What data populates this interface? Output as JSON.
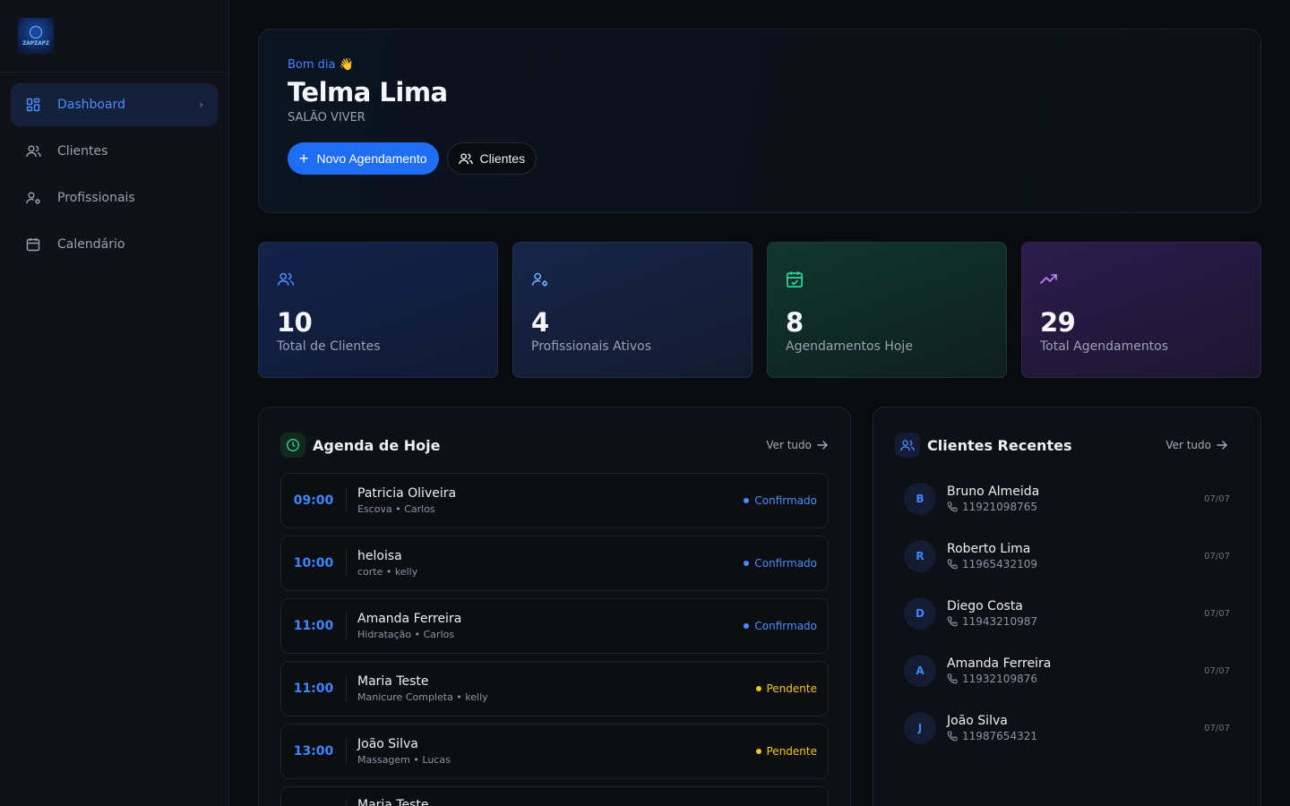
{
  "logo": {
    "text": "ZAPZAPZ"
  },
  "sidebar": {
    "items": [
      {
        "label": "Dashboard",
        "icon": "dashboard-icon",
        "active": true
      },
      {
        "label": "Clientes",
        "icon": "users-icon"
      },
      {
        "label": "Profissionais",
        "icon": "user-cog-icon"
      },
      {
        "label": "Calendário",
        "icon": "calendar-icon"
      }
    ]
  },
  "hero": {
    "greeting": "Bom dia 👋",
    "name": "Telma Lima",
    "salon": "SALÃO VIVER",
    "primary_button": "Novo Agendamento",
    "secondary_button": "Clientes"
  },
  "stats": [
    {
      "value": "10",
      "label": "Total de Clientes",
      "icon": "users-icon",
      "color": "#4a8dff"
    },
    {
      "value": "4",
      "label": "Profissionais Ativos",
      "icon": "user-cog-icon",
      "color": "#6ea8ff"
    },
    {
      "value": "8",
      "label": "Agendamentos Hoje",
      "icon": "calendar-check-icon",
      "color": "#2fd49a"
    },
    {
      "value": "29",
      "label": "Total Agendamentos",
      "icon": "trending-up-icon",
      "color": "#b98cff"
    }
  ],
  "agenda": {
    "title": "Agenda de Hoje",
    "see_all": "Ver tudo",
    "appointments": [
      {
        "time": "09:00",
        "client": "Patricia Oliveira",
        "details": "Escova • Carlos",
        "status": "Confirmado",
        "status_color": "#4a8dff"
      },
      {
        "time": "10:00",
        "client": "heloisa",
        "details": "corte • kelly",
        "status": "Confirmado",
        "status_color": "#4a8dff"
      },
      {
        "time": "11:00",
        "client": "Amanda Ferreira",
        "details": "Hidratação • Carlos",
        "status": "Confirmado",
        "status_color": "#4a8dff"
      },
      {
        "time": "11:00",
        "client": "Maria Teste",
        "details": "Manicure Completa • kelly",
        "status": "Pendente",
        "status_color": "#f5c518"
      },
      {
        "time": "13:00",
        "client": "João Silva",
        "details": "Massagem • Lucas",
        "status": "Pendente",
        "status_color": "#f5c518"
      },
      {
        "time": "",
        "client": "Maria Teste",
        "details": "",
        "status": "",
        "status_color": "#4a8dff"
      }
    ]
  },
  "recent": {
    "title": "Clientes Recentes",
    "see_all": "Ver tudo",
    "clients": [
      {
        "initial": "B",
        "name": "Bruno Almeida",
        "phone": "11921098765",
        "date": "07/07"
      },
      {
        "initial": "R",
        "name": "Roberto Lima",
        "phone": "11965432109",
        "date": "07/07"
      },
      {
        "initial": "D",
        "name": "Diego Costa",
        "phone": "11943210987",
        "date": "07/07"
      },
      {
        "initial": "A",
        "name": "Amanda Ferreira",
        "phone": "11932109876",
        "date": "07/07"
      },
      {
        "initial": "J",
        "name": "João Silva",
        "phone": "11987654321",
        "date": "07/07"
      }
    ]
  }
}
